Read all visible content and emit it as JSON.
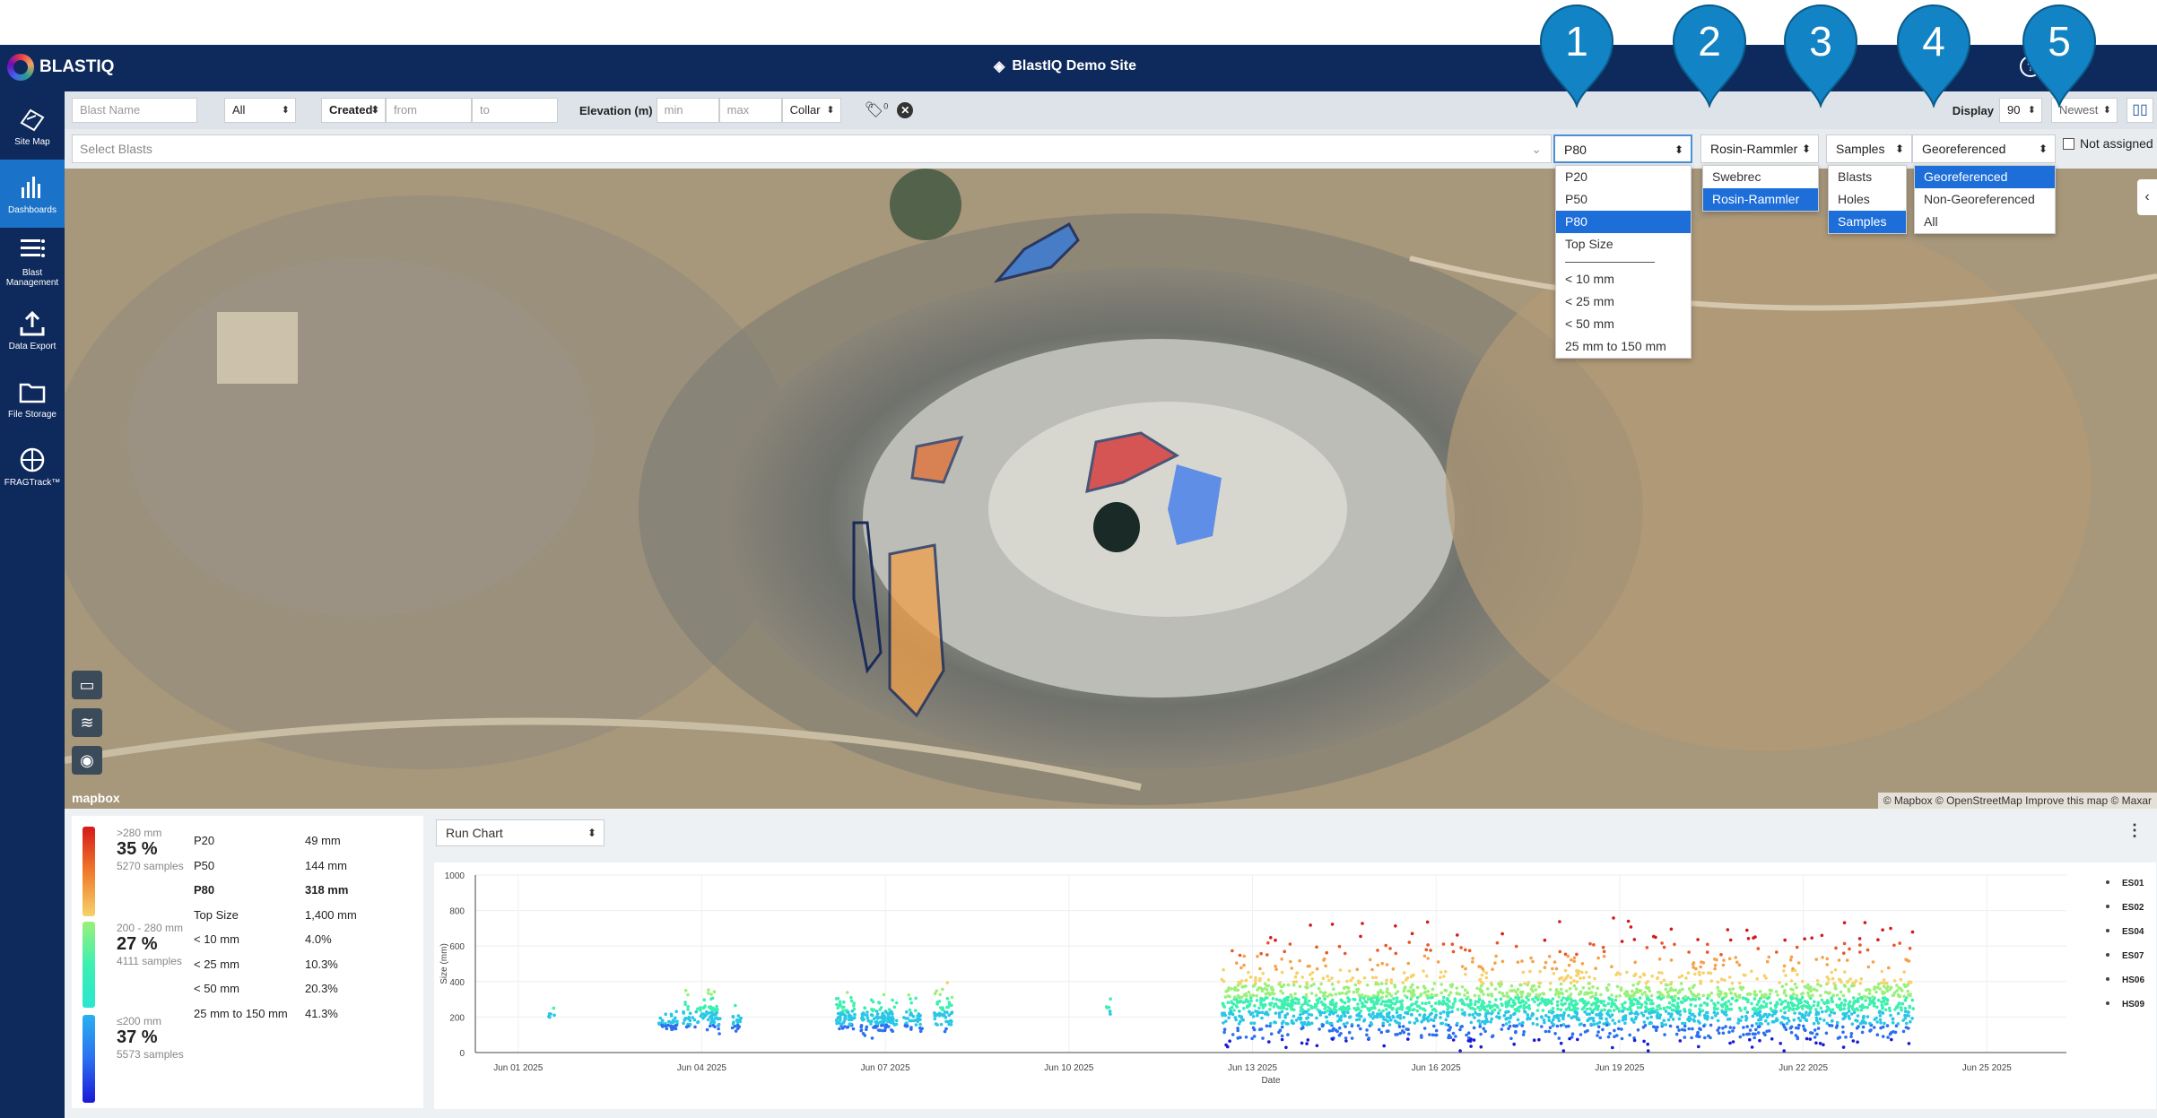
{
  "app": {
    "name": "BLASTIQ",
    "site": "BlastIQ Demo Site"
  },
  "sidebar": {
    "items": [
      {
        "label": "Site Map",
        "icon": "site-map-icon"
      },
      {
        "label": "Dashboards",
        "icon": "dashboards-icon",
        "active": true
      },
      {
        "label": "Blast Management",
        "icon": "blast-management-icon"
      },
      {
        "label": "Data Export",
        "icon": "data-export-icon"
      },
      {
        "label": "File Storage",
        "icon": "file-storage-icon"
      },
      {
        "label": "FRAGTrack™",
        "icon": "fragtrack-icon"
      }
    ]
  },
  "filters": {
    "blast_name_placeholder": "Blast Name",
    "all_value": "All",
    "created_value": "Created",
    "from_placeholder": "from",
    "to_placeholder": "to",
    "elevation_label": "Elevation (m)",
    "min_placeholder": "min",
    "max_placeholder": "max",
    "collar_value": "Collar",
    "tag_count": "0",
    "display_label": "Display",
    "display_value": "90",
    "sort_value": "Newest"
  },
  "filter2": {
    "select_blasts_placeholder": "Select Blasts",
    "size_value": "P80",
    "model_value": "Rosin-Rammler",
    "samples_value": "Samples",
    "geo_value": "Georeferenced",
    "not_assigned_label": "Not assigned"
  },
  "dropdowns": {
    "size": [
      "P20",
      "P50",
      "P80",
      "Top Size",
      "---",
      "< 10 mm",
      "< 25 mm",
      "< 50 mm",
      "25 mm to 150 mm"
    ],
    "size_selected": "P80",
    "model": [
      "Swebrec",
      "Rosin-Rammler"
    ],
    "model_selected": "Rosin-Rammler",
    "samples": [
      "Blasts",
      "Holes",
      "Samples"
    ],
    "samples_selected": "Samples",
    "geo": [
      "Georeferenced",
      "Non-Georeferenced",
      "All"
    ],
    "geo_selected": "Georeferenced"
  },
  "callouts": [
    "1",
    "2",
    "3",
    "4",
    "5"
  ],
  "map": {
    "attribution": "© Mapbox © OpenStreetMap Improve this map © Maxar",
    "logo": "mapbox",
    "colors": {
      "water": "#1a2a26",
      "blast_outline": "#1a2a5a"
    }
  },
  "legend": {
    "groups": [
      {
        "range": ">280 mm",
        "pct": "35 %",
        "samples": "5270 samples"
      },
      {
        "range": "200 - 280 mm",
        "pct": "27 %",
        "samples": "4111 samples"
      },
      {
        "range": "≤200 mm",
        "pct": "37 %",
        "samples": "5573 samples"
      }
    ],
    "stats": [
      {
        "k": "P20",
        "v": "49 mm"
      },
      {
        "k": "P50",
        "v": "144 mm"
      },
      {
        "k": "P80",
        "v": "318 mm",
        "bold": true
      },
      {
        "k": "Top Size",
        "v": "1,400 mm"
      },
      {
        "k": "< 10 mm",
        "v": "4.0%"
      },
      {
        "k": "< 25 mm",
        "v": "10.3%"
      },
      {
        "k": "< 50 mm",
        "v": "20.3%"
      },
      {
        "k": "25 mm to 150 mm",
        "v": "41.3%"
      }
    ]
  },
  "chart_select": "Run Chart",
  "chart_data": {
    "type": "scatter",
    "xlabel": "Date",
    "ylabel": "Size (mm)",
    "ylim": [
      0,
      1000
    ],
    "yticks": [
      "0",
      "200",
      "400",
      "600",
      "800",
      "1000"
    ],
    "xticks": [
      "Jun 01 2025",
      "Jun 04 2025",
      "Jun 07 2025",
      "Jun 10 2025",
      "Jun 13 2025",
      "Jun 16 2025",
      "Jun 19 2025",
      "Jun 22 2025",
      "Jun 25 2025"
    ],
    "legend_position": "right",
    "series": [
      {
        "name": "ES01"
      },
      {
        "name": "ES02"
      },
      {
        "name": "ES04"
      },
      {
        "name": "ES07"
      },
      {
        "name": "HS06"
      },
      {
        "name": "HS09"
      }
    ],
    "clusters": [
      {
        "day_start": 0.5,
        "day_end": 0.6,
        "median": 200,
        "spread": 60,
        "count": 6
      },
      {
        "day_start": 2.3,
        "day_end": 2.6,
        "median": 150,
        "spread": 80,
        "count": 40
      },
      {
        "day_start": 2.7,
        "day_end": 3.3,
        "median": 190,
        "spread": 140,
        "count": 90
      },
      {
        "day_start": 3.5,
        "day_end": 3.65,
        "median": 160,
        "spread": 90,
        "count": 20
      },
      {
        "day_start": 5.2,
        "day_end": 5.5,
        "median": 200,
        "spread": 170,
        "count": 70
      },
      {
        "day_start": 5.6,
        "day_end": 6.2,
        "median": 170,
        "spread": 150,
        "count": 110
      },
      {
        "day_start": 6.3,
        "day_end": 6.6,
        "median": 180,
        "spread": 150,
        "count": 40
      },
      {
        "day_start": 6.8,
        "day_end": 7.1,
        "median": 200,
        "spread": 150,
        "count": 50
      },
      {
        "day_start": 9.6,
        "day_end": 9.7,
        "median": 250,
        "spread": 120,
        "count": 6
      },
      {
        "day_start": 11.5,
        "day_end": 22.8,
        "median": 240,
        "spread": 380,
        "count": 2600
      }
    ],
    "point_colors": [
      "#1a1ad6",
      "#2b6ff0",
      "#29c7e6",
      "#3df0b0",
      "#9af07a",
      "#f5d26a",
      "#f5a14a",
      "#e8572a",
      "#d41a1a"
    ]
  }
}
